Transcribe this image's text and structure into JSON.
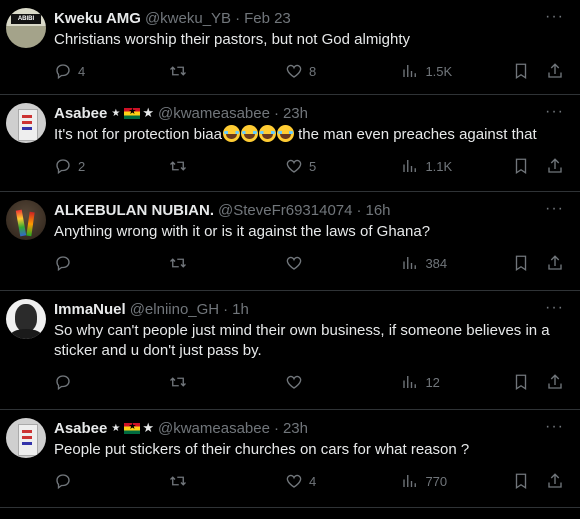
{
  "tweets": [
    {
      "name": "Kweku AMG",
      "handle": "@kweku_YB",
      "time": "Feb 23",
      "text": "Christians worship their pastors, but not God almighty",
      "avatar_logo": "ABIBI",
      "reply_count": "4",
      "retweet_count": "",
      "like_count": "8",
      "views": "1.5K"
    },
    {
      "name": "Asabee",
      "handle": "@kwameasabee",
      "time": "23h",
      "text_before": "It's not for protection biaa",
      "emoji_count": 4,
      "text_after": " the man even preaches against that",
      "reply_count": "2",
      "retweet_count": "",
      "like_count": "5",
      "views": "1.1K"
    },
    {
      "name": "ALKEBULAN NUBIAN.",
      "handle": "@SteveFr69314074",
      "time": "16h",
      "text": "Anything wrong with it or is it against the laws of Ghana?",
      "reply_count": "",
      "retweet_count": "",
      "like_count": "",
      "views": "384"
    },
    {
      "name": "ImmaNuel",
      "handle": "@elniino_GH",
      "time": "1h",
      "text": "So why can't people just mind their own business, if someone believes in a sticker and u don't just pass by.",
      "reply_count": "",
      "retweet_count": "",
      "like_count": "",
      "views": "12"
    },
    {
      "name": "Asabee",
      "handle": "@kwameasabee",
      "time": "23h",
      "text": "People put stickers of their churches on cars for what reason ?",
      "reply_count": "",
      "retweet_count": "",
      "like_count": "4",
      "views": "770"
    }
  ],
  "ui": {
    "separator": "·",
    "more": "···",
    "star": "★"
  },
  "icons": {
    "reply": "reply-icon",
    "retweet": "retweet-icon",
    "like": "heart-icon",
    "views": "views-icon",
    "bookmark": "bookmark-icon",
    "share": "share-icon",
    "more": "more-icon"
  },
  "colors": {
    "background": "#000000",
    "text": "#e7e9ea",
    "muted": "#71767b",
    "border": "#2f3336"
  }
}
